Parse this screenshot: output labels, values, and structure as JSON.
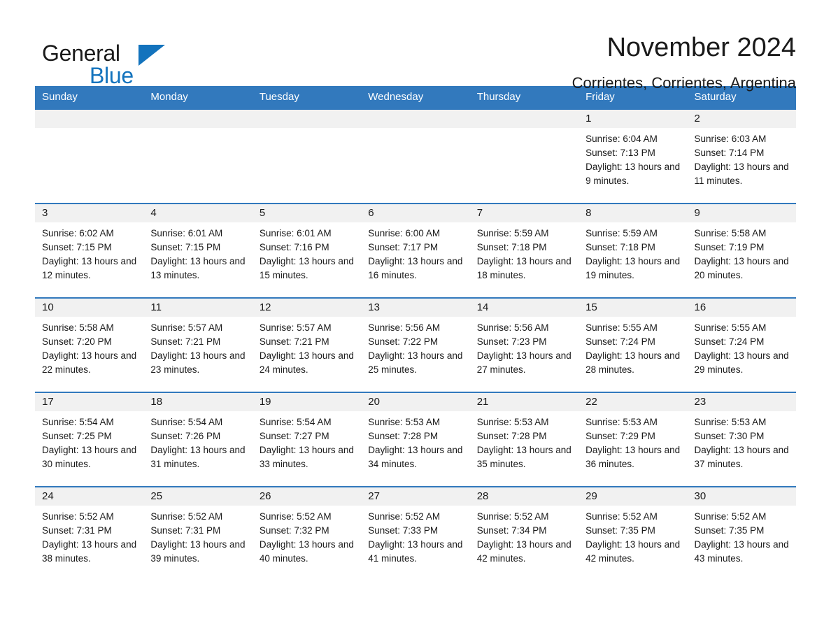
{
  "brand": {
    "name_part1": "General",
    "name_part2": "Blue",
    "triangle_color": "#1373bd"
  },
  "header": {
    "title": "November 2024",
    "subtitle": "Corrientes, Corrientes, Argentina"
  },
  "theme": {
    "header_blue": "#3279bd",
    "daynum_gray": "#f1f1f1",
    "text_black": "#1a1a1a"
  },
  "weekdays": [
    "Sunday",
    "Monday",
    "Tuesday",
    "Wednesday",
    "Thursday",
    "Friday",
    "Saturday"
  ],
  "weeks": [
    [
      {
        "day": "",
        "sunrise": "",
        "sunset": "",
        "daylight": ""
      },
      {
        "day": "",
        "sunrise": "",
        "sunset": "",
        "daylight": ""
      },
      {
        "day": "",
        "sunrise": "",
        "sunset": "",
        "daylight": ""
      },
      {
        "day": "",
        "sunrise": "",
        "sunset": "",
        "daylight": ""
      },
      {
        "day": "",
        "sunrise": "",
        "sunset": "",
        "daylight": ""
      },
      {
        "day": "1",
        "sunrise": "Sunrise: 6:04 AM",
        "sunset": "Sunset: 7:13 PM",
        "daylight": "Daylight: 13 hours and 9 minutes."
      },
      {
        "day": "2",
        "sunrise": "Sunrise: 6:03 AM",
        "sunset": "Sunset: 7:14 PM",
        "daylight": "Daylight: 13 hours and 11 minutes."
      }
    ],
    [
      {
        "day": "3",
        "sunrise": "Sunrise: 6:02 AM",
        "sunset": "Sunset: 7:15 PM",
        "daylight": "Daylight: 13 hours and 12 minutes."
      },
      {
        "day": "4",
        "sunrise": "Sunrise: 6:01 AM",
        "sunset": "Sunset: 7:15 PM",
        "daylight": "Daylight: 13 hours and 13 minutes."
      },
      {
        "day": "5",
        "sunrise": "Sunrise: 6:01 AM",
        "sunset": "Sunset: 7:16 PM",
        "daylight": "Daylight: 13 hours and 15 minutes."
      },
      {
        "day": "6",
        "sunrise": "Sunrise: 6:00 AM",
        "sunset": "Sunset: 7:17 PM",
        "daylight": "Daylight: 13 hours and 16 minutes."
      },
      {
        "day": "7",
        "sunrise": "Sunrise: 5:59 AM",
        "sunset": "Sunset: 7:18 PM",
        "daylight": "Daylight: 13 hours and 18 minutes."
      },
      {
        "day": "8",
        "sunrise": "Sunrise: 5:59 AM",
        "sunset": "Sunset: 7:18 PM",
        "daylight": "Daylight: 13 hours and 19 minutes."
      },
      {
        "day": "9",
        "sunrise": "Sunrise: 5:58 AM",
        "sunset": "Sunset: 7:19 PM",
        "daylight": "Daylight: 13 hours and 20 minutes."
      }
    ],
    [
      {
        "day": "10",
        "sunrise": "Sunrise: 5:58 AM",
        "sunset": "Sunset: 7:20 PM",
        "daylight": "Daylight: 13 hours and 22 minutes."
      },
      {
        "day": "11",
        "sunrise": "Sunrise: 5:57 AM",
        "sunset": "Sunset: 7:21 PM",
        "daylight": "Daylight: 13 hours and 23 minutes."
      },
      {
        "day": "12",
        "sunrise": "Sunrise: 5:57 AM",
        "sunset": "Sunset: 7:21 PM",
        "daylight": "Daylight: 13 hours and 24 minutes."
      },
      {
        "day": "13",
        "sunrise": "Sunrise: 5:56 AM",
        "sunset": "Sunset: 7:22 PM",
        "daylight": "Daylight: 13 hours and 25 minutes."
      },
      {
        "day": "14",
        "sunrise": "Sunrise: 5:56 AM",
        "sunset": "Sunset: 7:23 PM",
        "daylight": "Daylight: 13 hours and 27 minutes."
      },
      {
        "day": "15",
        "sunrise": "Sunrise: 5:55 AM",
        "sunset": "Sunset: 7:24 PM",
        "daylight": "Daylight: 13 hours and 28 minutes."
      },
      {
        "day": "16",
        "sunrise": "Sunrise: 5:55 AM",
        "sunset": "Sunset: 7:24 PM",
        "daylight": "Daylight: 13 hours and 29 minutes."
      }
    ],
    [
      {
        "day": "17",
        "sunrise": "Sunrise: 5:54 AM",
        "sunset": "Sunset: 7:25 PM",
        "daylight": "Daylight: 13 hours and 30 minutes."
      },
      {
        "day": "18",
        "sunrise": "Sunrise: 5:54 AM",
        "sunset": "Sunset: 7:26 PM",
        "daylight": "Daylight: 13 hours and 31 minutes."
      },
      {
        "day": "19",
        "sunrise": "Sunrise: 5:54 AM",
        "sunset": "Sunset: 7:27 PM",
        "daylight": "Daylight: 13 hours and 33 minutes."
      },
      {
        "day": "20",
        "sunrise": "Sunrise: 5:53 AM",
        "sunset": "Sunset: 7:28 PM",
        "daylight": "Daylight: 13 hours and 34 minutes."
      },
      {
        "day": "21",
        "sunrise": "Sunrise: 5:53 AM",
        "sunset": "Sunset: 7:28 PM",
        "daylight": "Daylight: 13 hours and 35 minutes."
      },
      {
        "day": "22",
        "sunrise": "Sunrise: 5:53 AM",
        "sunset": "Sunset: 7:29 PM",
        "daylight": "Daylight: 13 hours and 36 minutes."
      },
      {
        "day": "23",
        "sunrise": "Sunrise: 5:53 AM",
        "sunset": "Sunset: 7:30 PM",
        "daylight": "Daylight: 13 hours and 37 minutes."
      }
    ],
    [
      {
        "day": "24",
        "sunrise": "Sunrise: 5:52 AM",
        "sunset": "Sunset: 7:31 PM",
        "daylight": "Daylight: 13 hours and 38 minutes."
      },
      {
        "day": "25",
        "sunrise": "Sunrise: 5:52 AM",
        "sunset": "Sunset: 7:31 PM",
        "daylight": "Daylight: 13 hours and 39 minutes."
      },
      {
        "day": "26",
        "sunrise": "Sunrise: 5:52 AM",
        "sunset": "Sunset: 7:32 PM",
        "daylight": "Daylight: 13 hours and 40 minutes."
      },
      {
        "day": "27",
        "sunrise": "Sunrise: 5:52 AM",
        "sunset": "Sunset: 7:33 PM",
        "daylight": "Daylight: 13 hours and 41 minutes."
      },
      {
        "day": "28",
        "sunrise": "Sunrise: 5:52 AM",
        "sunset": "Sunset: 7:34 PM",
        "daylight": "Daylight: 13 hours and 42 minutes."
      },
      {
        "day": "29",
        "sunrise": "Sunrise: 5:52 AM",
        "sunset": "Sunset: 7:35 PM",
        "daylight": "Daylight: 13 hours and 42 minutes."
      },
      {
        "day": "30",
        "sunrise": "Sunrise: 5:52 AM",
        "sunset": "Sunset: 7:35 PM",
        "daylight": "Daylight: 13 hours and 43 minutes."
      }
    ]
  ]
}
